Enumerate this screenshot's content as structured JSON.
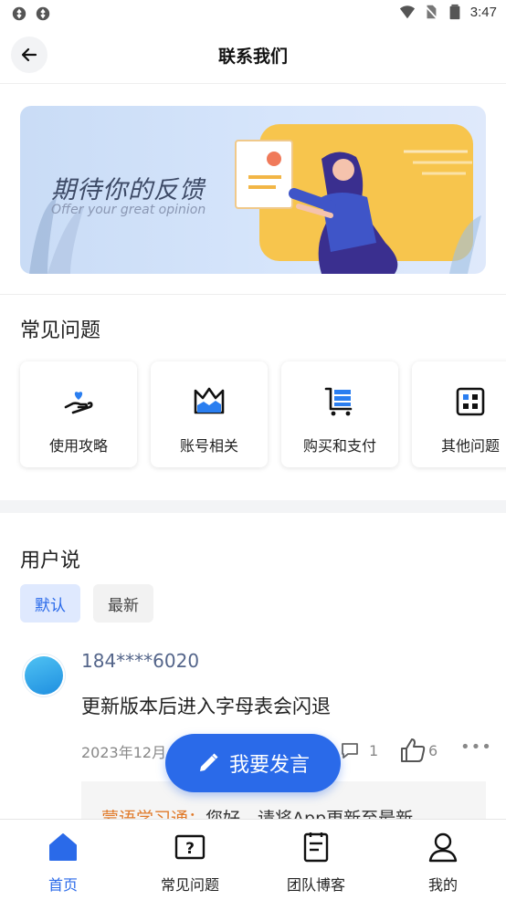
{
  "status_bar": {
    "time": "3:47",
    "left_icons": [
      "app-notification-icon",
      "app-notification-icon"
    ],
    "right_icons": [
      "wifi-icon",
      "no-sim-icon",
      "battery-icon"
    ]
  },
  "header": {
    "title": "联系我们",
    "back_icon": "arrow-left-icon"
  },
  "banner": {
    "title": "期待你的反馈",
    "subtitle": "Offer your great opinion"
  },
  "faq": {
    "title": "常见问题",
    "items": [
      {
        "label": "使用攻略",
        "icon": "heart-hand-icon"
      },
      {
        "label": "账号相关",
        "icon": "crown-icon"
      },
      {
        "label": "购买和支付",
        "icon": "cart-icon"
      },
      {
        "label": "其他问题",
        "icon": "grid-icon"
      }
    ]
  },
  "user_says": {
    "title": "用户说",
    "filters": [
      {
        "label": "默认",
        "active": true
      },
      {
        "label": "最新",
        "active": false
      }
    ],
    "post": {
      "username": "184****6020",
      "content": "更新版本后进入字母表会闪退",
      "date": "2023年12月",
      "comments": "1",
      "likes": "6",
      "reply_name": "蒙语学习通：",
      "reply_text": "您好，请将App更新至最新"
    }
  },
  "fab": {
    "label": "我要发言",
    "icon": "pencil-icon"
  },
  "bottom_nav": {
    "items": [
      {
        "label": "首页",
        "icon": "home-icon",
        "active": true
      },
      {
        "label": "常见问题",
        "icon": "question-box-icon",
        "active": false
      },
      {
        "label": "团队博客",
        "icon": "document-icon",
        "active": false
      },
      {
        "label": "我的",
        "icon": "user-icon",
        "active": false
      }
    ]
  },
  "colors": {
    "accent": "#2a6ae9",
    "username": "#54658a",
    "reply_name": "#e07a2a"
  }
}
